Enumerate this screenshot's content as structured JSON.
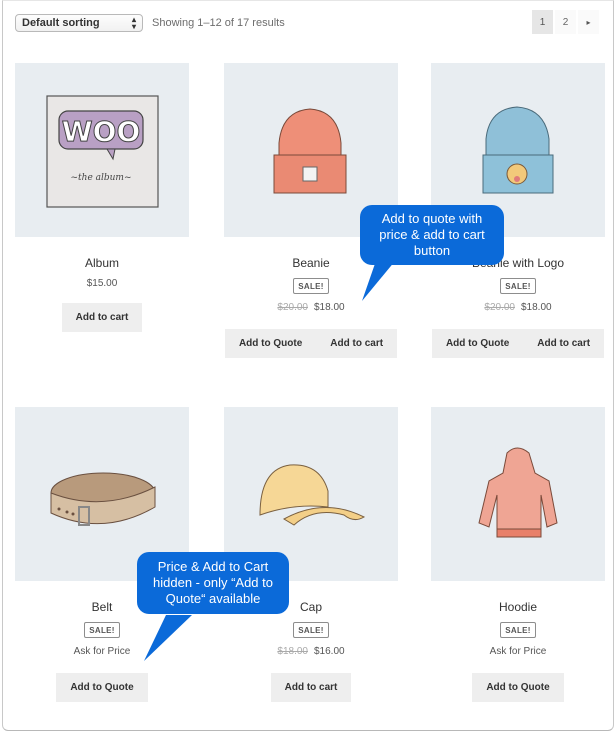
{
  "toolbar": {
    "sort_selected": "Default sorting",
    "result_count": "Showing 1–12 of 17 results",
    "pagination": {
      "pages": [
        "1",
        "2"
      ],
      "current": "1",
      "next_icon": "▸"
    }
  },
  "products": [
    {
      "title": "Album",
      "sale_badge": null,
      "regular_price": null,
      "price": "$15.00",
      "buttons": [
        "Add to cart"
      ],
      "image": "woo-album-icon"
    },
    {
      "title": "Beanie",
      "sale_badge": "SALE!",
      "regular_price": "$20.00",
      "price": "$18.00",
      "buttons": [
        "Add to Quote",
        "Add to cart"
      ],
      "image": "orange-beanie-icon"
    },
    {
      "title": "Beanie with Logo",
      "sale_badge": "SALE!",
      "regular_price": "$20.00",
      "price": "$18.00",
      "buttons": [
        "Add to Quote",
        "Add to cart"
      ],
      "image": "blue-beanie-icon"
    },
    {
      "title": "Belt",
      "sale_badge": "SALE!",
      "regular_price": null,
      "price": "Ask for Price",
      "buttons": [
        "Add to Quote"
      ],
      "image": "belt-icon"
    },
    {
      "title": "Cap",
      "sale_badge": "SALE!",
      "regular_price": "$18.00",
      "price": "$16.00",
      "buttons": [
        "Add to cart"
      ],
      "image": "cap-icon"
    },
    {
      "title": "Hoodie",
      "sale_badge": "SALE!",
      "regular_price": null,
      "price": "Ask for Price",
      "buttons": [
        "Add to Quote"
      ],
      "image": "hoodie-icon"
    }
  ],
  "callouts": [
    {
      "text": "Add to quote with price & add to cart button"
    },
    {
      "text": "Price & Add to Cart hidden - only “Add to Quote“ available"
    }
  ],
  "colors": {
    "callout": "#0b6ad9",
    "image_bg": "#e8edf1",
    "button_bg": "#eeeeee"
  }
}
